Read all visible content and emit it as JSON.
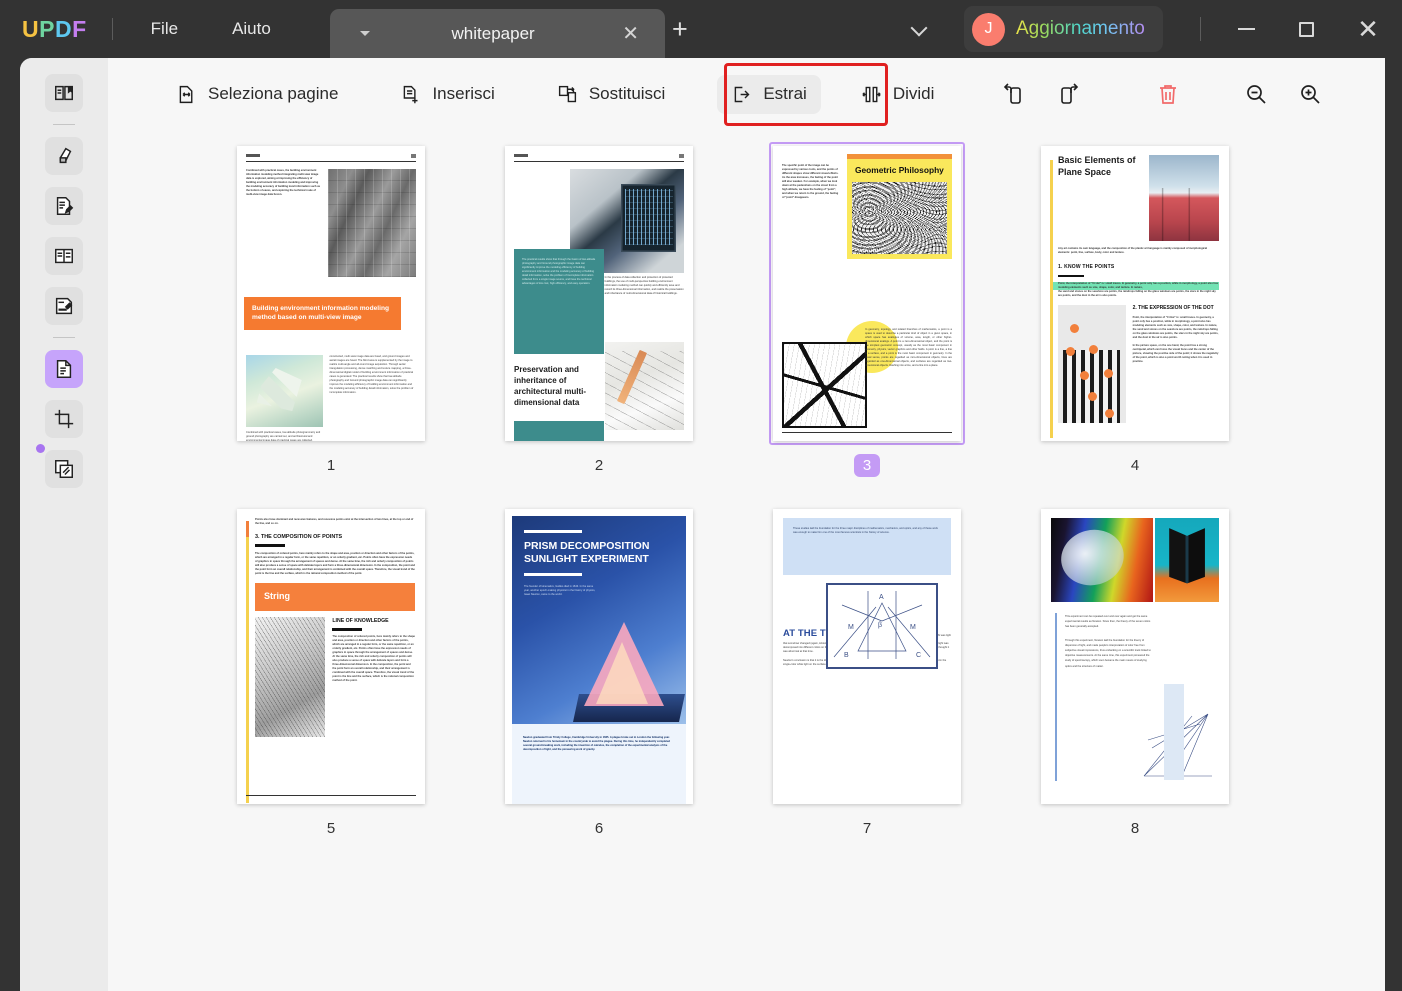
{
  "app": {
    "logo_letters": [
      "U",
      "P",
      "D",
      "F"
    ],
    "menus": [
      {
        "label": "File",
        "name": "menu-file"
      },
      {
        "label": "Aiuto",
        "name": "menu-aiuto"
      }
    ],
    "tab": {
      "title": "whitepaper",
      "close_label": "✕",
      "caret": "caret-down"
    },
    "new_tab_label": "+",
    "account": {
      "avatar_initial": "J",
      "label": "Aggiornamento"
    },
    "window_controls": {
      "minimize": "—",
      "maximize": "□",
      "close": "✕"
    },
    "colors": {
      "titlebar_bg": "#333333",
      "accent_purple": "#c49bf5",
      "highlight_red": "#e02020",
      "shell_bg": "#f7f7f7",
      "rail_bg": "#ebebeb",
      "avatar_bg": "#fa7d6e",
      "delete_red": "#f26a6a"
    }
  },
  "sidebar": {
    "items": [
      {
        "label": "Lettura",
        "icon": "reader-icon",
        "active": false
      },
      {
        "label": "Commenta",
        "icon": "highlighter-icon",
        "active": false
      },
      {
        "label": "Modifica PDF",
        "icon": "edit-document-icon",
        "active": false
      },
      {
        "label": "Modulo",
        "icon": "form-icon",
        "active": false
      },
      {
        "label": "Firma",
        "icon": "signature-icon",
        "active": false
      },
      {
        "label": "Organizza pagine",
        "icon": "organize-pages-icon",
        "active": true
      },
      {
        "label": "Ritaglia",
        "icon": "crop-icon",
        "active": false
      },
      {
        "label": "Batch",
        "icon": "batch-pages-icon",
        "active": false
      }
    ]
  },
  "toolbar": {
    "items": [
      {
        "label": "Seleziona pagine",
        "icon": "select-pages-icon",
        "highlighted": false
      },
      {
        "label": "Inserisci",
        "icon": "insert-page-icon",
        "highlighted": false
      },
      {
        "label": "Sostituisci",
        "icon": "replace-page-icon",
        "highlighted": false
      },
      {
        "label": "Estrai",
        "icon": "extract-page-icon",
        "highlighted": true
      },
      {
        "label": "Dividi",
        "icon": "split-page-icon",
        "highlighted": false
      }
    ],
    "icon_buttons": [
      {
        "name": "rotate-left-button",
        "icon": "rotate-left-icon"
      },
      {
        "name": "rotate-right-button",
        "icon": "rotate-right-icon"
      },
      {
        "name": "delete-button",
        "icon": "trash-icon"
      },
      {
        "name": "zoom-out-button",
        "icon": "zoom-out-icon"
      },
      {
        "name": "zoom-in-button",
        "icon": "zoom-in-icon"
      }
    ]
  },
  "pages": [
    {
      "number": "1",
      "selected": false,
      "title": "Building environment information modeling method based on multi-view image",
      "left_text": "Combined with practical cases, the building environment information modeling method integrating multi-view image data is explored, aiming at improving the efficiency of building environment information modeling and improving the modeling accuracy of building local information such as the bottom of eaves, and exploring the technical route of multi-view image data fusion.",
      "caption": "Combined with practical cases, low-altitude photogrammetry and ground photography are carried out, and architectural and environmental image data of practical cases are collected, connection points are constructed, multi-view image data are",
      "right_text": "constructed, multi-view image data are fused, and ground images and aerial images are fused. The blind area is supplemented by the image to realize multi-angle and all-round image acquisition. Through aerial triangulation processing, dense matching and texture mapping, a three-dimensional digital model of building environment information of practical cases is generated. The practical results show that low-altitude photography and Ground photographic image data can significantly improve the modeling efficiency of building environment information and the modeling accuracy of building detail information, solve the problem of incomplete information."
    },
    {
      "number": "2",
      "selected": false,
      "title": "Preservation and inheritance of architectural multi-dimensional data",
      "teal_text": "The practical results show that through the fusion of low-altitude photography and Ground photographic image data can significantly improve the modeling efficiency of building environment information and the modeling accuracy of building detail information, solve the problem of incomplete information collected from a single image source, and have the technical advantages of low cost, high efficiency, and easy operation.",
      "right_text": "In the process of data collection and protection of protected buildings, the use of multi-perspective building environment information modeling method can quickly and efficiently save and record its three-dimensional information, and realize the preservation and inheritance of multi-dimensional data of historical buildings."
    },
    {
      "number": "3",
      "selected": true,
      "title": "Geometric Philosophy",
      "left_text": "The specific point of the image can be expressed by various tools, and the points of different shapes show different visual effects. As the area increases, the feeling of the point will also weaken. For example, when we look down at the pedestrians on the street from a high altitude, we have the feeling of \"point\", and when we return to the ground, the feeling of \"point\" disappears.",
      "right_text": "In geometry, topology, and related branches of mathematics, a point is a space is used to describe a particular kind of object in a given space, in which space has analogies of volume, area, length, or other higher-dimensional analogs. A point is a zero-dimensional object, and the point is the simplest geometric concept, usually as the most basic component in geometry, physics, vector graphics and other fields. A point is a line, a line is a surface, and a point is the most basic component in geometry. In the usual sense, points are regarded as zero-dimensional objects, lines are regarded as one-dimensional objects, and surfaces are regarded as two-dimensional objects. Dashing into a line, and a line into a plane."
    },
    {
      "number": "4",
      "selected": false,
      "title": "Basic Elements of Plane Space",
      "intro": "Any art contains its own language, and the composition of the plastic art language is mainly composed of morphological elements: point, line, surface, body, color and texture.",
      "section1": "1. KNOW THE POINTS",
      "highlight": "Point, the interpretation of \"Ci Hai\" is: small traces. In geometry, a point only has a position, while in morphology, a point also has modeling elements such as size, shape, color, and texture. In nature,",
      "body1": "the sand and stones on the seashore are points, the raindrops falling on the glass windows are points, the stars in the night sky are points, and the dust in the air is also points.",
      "section2": "2. THE EXPRESSION OF THE DOT",
      "body2": "Point, the interpretation of \"Ci Hai\" is: small traces. In geometry, a point only has a position, while in morphology, a point also has modeling elements such as size, shape, color, and texture. In nature, the sand and stones on the seashore are points, the raindrops falling on the glass windows are points, the stars in the night sky are points, and the dust in the air is also points.",
      "body3": "In the picture space, on the one hand, the point has a strong centripetal, which can focus the visual focus and the center of the picture, showing the positive side of the point; it shows the negativity of the point, which is also a point worth noting when it is used in practice."
    },
    {
      "number": "5",
      "selected": false,
      "intro": "Points also have dominant and recessive features, and recessive points exist at the intersection of two lines, at the top or end of the line, and so on.",
      "section": "3. THE COMPOSITION OF POINTS",
      "body": "The composition of ordered points, here mainly refers to the shape and area, position or direction and other factors of the points, which are arranged in a regular form, or the same repetition, or an orderly gradient, etc. Points often have the expression needs of graphics in space through the arrangement of spaces and dense. At the same time, the rich and orderly composition of points will also produce a sense of space with delicate layers and form a three-dimensional dimension. In the composition, the point and the point form an overall relationship, and their arrangement is combined with the overall space. Therefore, the visual trend of the point is the line and the surface, which is the rational composition method of the point.",
      "banner": "String",
      "subtitle": "LINE OF KNOWLEDGE",
      "body2": "The composition of ordered points, here mainly refers to the shape and area, position or direction and other factors of the points, which are arranged in a regular form, or the same repetition, or an orderly gradient, etc. Points often have the expression needs of graphics in space through the arrangement of spaces and dense. At the same time, the rich and orderly composition of points will also produce a sense of space with delicate layers and form a three-dimensional dimension. In the composition, the point and the point form an overall relationship, and their arrangement is combined with the overall space. Therefore, the visual trend of the point is the line and the surface, which is the rational composition method of the point."
    },
    {
      "number": "6",
      "selected": false,
      "title": "PRISM DECOMPOSITION SUNLIGHT EXPERIMENT",
      "lead": "The founder of kinematics, Galileo died in 1643. In the same year, another epoch-making physicist in the history of physics, Isaac Newton, came to the world.",
      "footer": "Newton graduated from Trinity College, Cambridge University in 1665. A plague broke out in London the following year. Newton returned to his hometown in the countryside to avoid the plague. During this time, he independently completed several ground-breaking work, including the invention of calculus, the completion of the experimental analysis of the decomposition of light, and the pioneering work of gravity."
    },
    {
      "number": "7",
      "selected": false,
      "intro": "These studies laid the foundation for the three major disciplines of mathematics, mechanics, and optics, and any of these work was enough to make him one of the most famous scientists in the history of science.",
      "heading": "AT THE TIME",
      "body": "everyone thought that white light was pure light with no other color, and colored light was light that somehow changed (again, Aristotle's theory). To test this hypothesis, Newton put a prism under the sunlight, through the prism, the light was decomposed into different colors on the wall, which we later called the spectrum. People knew about the colors of the rainbow, but they thought it was abnormal at that time.",
      "body2": "Newton's conclusion is that it is the different spectrums of these basic colors of red, orange, yellow, green, blue, indigo, and violet that form the single-color white light on the surface.",
      "diagram_labels": [
        "A",
        "β",
        "M",
        "M",
        "B",
        "C"
      ]
    },
    {
      "number": "8",
      "selected": false,
      "body": "This experiment can be repeated over and over again and get the same experimental results as Newton. Since then, the theory of the seven colors has been generally accepted.",
      "body2": "Through this experiment, Newton laid the foundation for the theory of dispersion of light, and made people's interpretation of color free from subjective visual impressions, thus embarking on a scientific track linked to objective measurements. At the same time, this experiment pioneered the study of spectroscopy, which soon became the main means of studying optics and the structure of matter."
    }
  ]
}
